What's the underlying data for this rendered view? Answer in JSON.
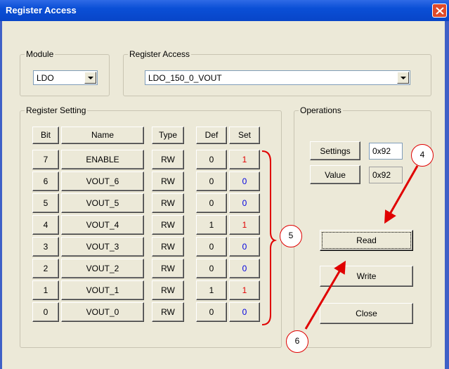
{
  "window": {
    "title": "Register Access"
  },
  "module": {
    "label": "Module",
    "value": "LDO"
  },
  "register_access": {
    "label": "Register Access",
    "value": "LDO_150_0_VOUT"
  },
  "register_setting": {
    "label": "Register Setting",
    "headers": {
      "bit": "Bit",
      "name": "Name",
      "type": "Type",
      "def": "Def",
      "set": "Set"
    },
    "rows": [
      {
        "bit": "7",
        "name": "ENABLE",
        "type": "RW",
        "def": "0",
        "set": "1"
      },
      {
        "bit": "6",
        "name": "VOUT_6",
        "type": "RW",
        "def": "0",
        "set": "0"
      },
      {
        "bit": "5",
        "name": "VOUT_5",
        "type": "RW",
        "def": "0",
        "set": "0"
      },
      {
        "bit": "4",
        "name": "VOUT_4",
        "type": "RW",
        "def": "1",
        "set": "1"
      },
      {
        "bit": "3",
        "name": "VOUT_3",
        "type": "RW",
        "def": "0",
        "set": "0"
      },
      {
        "bit": "2",
        "name": "VOUT_2",
        "type": "RW",
        "def": "0",
        "set": "0"
      },
      {
        "bit": "1",
        "name": "VOUT_1",
        "type": "RW",
        "def": "1",
        "set": "1"
      },
      {
        "bit": "0",
        "name": "VOUT_0",
        "type": "RW",
        "def": "0",
        "set": "0"
      }
    ]
  },
  "operations": {
    "label": "Operations",
    "settings_label": "Settings",
    "settings_value": "0x92",
    "value_label": "Value",
    "value_value": "0x92",
    "read_label": "Read",
    "write_label": "Write",
    "close_label": "Close"
  },
  "callouts": {
    "c4": "4",
    "c5": "5",
    "c6": "6"
  },
  "colors": {
    "set_one": "#e00000",
    "set_zero": "#0000e0",
    "annotation": "#e00000"
  }
}
